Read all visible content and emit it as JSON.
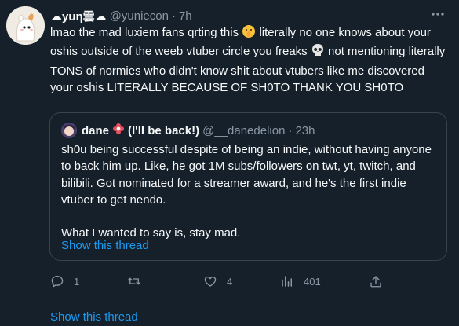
{
  "tweet": {
    "display_name": "☁yuη雲☁",
    "handle": "@yuniecon",
    "separator": "·",
    "time": "7h",
    "text_part1": "lmao the mad luxiem fans qrting this",
    "text_part2": "literally no one knows about your oshis outside of the weeb vtuber circle you freaks",
    "text_part3": "not mentioning literally TONS of normies who didn't know shit about vtubers like me discovered your oshis LITERALLY BECAUSE OF SH0TO THANK YOU SH0TO",
    "icons": [
      "more-icon",
      "shushing-face-emoji",
      "skull-emoji"
    ]
  },
  "quote": {
    "display_name": "dane",
    "name_suffix": "(I'll be back!)",
    "handle": "@__danedelion",
    "separator": "·",
    "time": "23h",
    "paragraph1": "sh0u being successful despite of being an indie, without having anyone to back him up. Like, he got 1M subs/followers on twt, yt, twitch, and bilibili. Got nominated for a streamer award, and he's the first indie vtuber to get nendo.",
    "paragraph2": "What I wanted to say is, stay mad.",
    "show_thread": "Show this thread"
  },
  "actions": {
    "reply_count": "1",
    "retweet_count": "",
    "like_count": "4",
    "views_count": "401",
    "icons": [
      "reply-icon",
      "retweet-icon",
      "like-icon",
      "views-icon",
      "share-icon"
    ]
  },
  "footer": {
    "show_thread": "Show this thread"
  },
  "colors": {
    "background": "#15202b",
    "text": "#f7f9f9",
    "secondary": "#8b98a5",
    "link": "#1d9bf0",
    "border": "#38444d"
  }
}
